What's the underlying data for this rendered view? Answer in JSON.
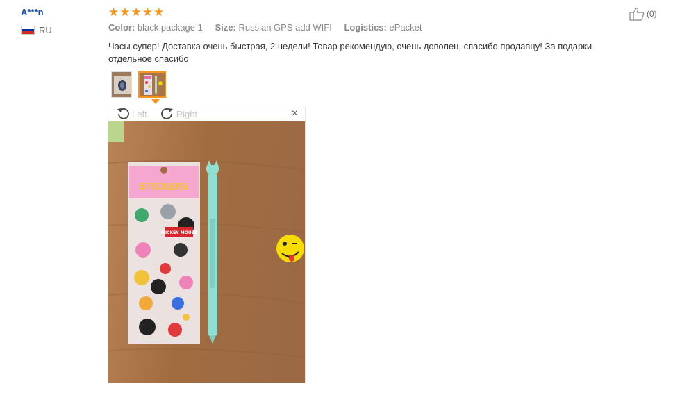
{
  "reviewer": {
    "name": "A***n",
    "country_code": "RU"
  },
  "rating": {
    "stars": 5,
    "max": 5
  },
  "attributes": [
    {
      "key": "Color:",
      "value": "black package 1"
    },
    {
      "key": "Size:",
      "value": "Russian GPS add WIFI"
    },
    {
      "key": "Logistics:",
      "value": "ePacket"
    }
  ],
  "review_text": "Часы супер! Доставка очень быстрая, 2 недели! Товар рекомендую, очень доволен, спасибо продавцу! За подарки отдельное спасибо",
  "helpful": {
    "count_label": "(0)",
    "icon": "thumbs-up-icon"
  },
  "viewer": {
    "rotate_left_label": "Left",
    "rotate_right_label": "Right",
    "close_symbol": "×",
    "sticker_text": "STICKERS",
    "mickey_text": "MICKEY MOUSE"
  },
  "colors": {
    "accent": "#f7941d",
    "author": "#1a4db3",
    "wood": "#a8754a"
  }
}
